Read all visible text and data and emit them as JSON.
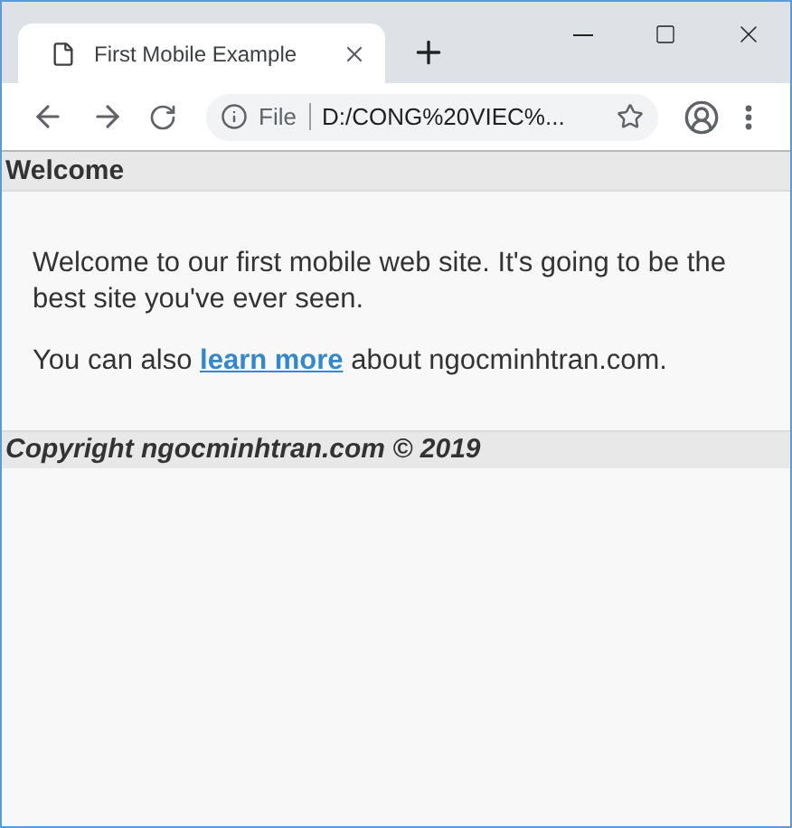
{
  "tab": {
    "title": "First Mobile Example",
    "selected": true
  },
  "address": {
    "scheme": "File",
    "url": "D:/CONG%20VIEC%..."
  },
  "page": {
    "header": "Welcome",
    "paragraphs": [
      {
        "text": "Welcome to our first mobile web site. It's going to be the best site you've ever seen."
      },
      {
        "before": "You can also ",
        "link": "learn more",
        "after": " about ngocminhtran.com."
      }
    ],
    "footer": "Copyright ngocminhtran.com © 2019"
  }
}
